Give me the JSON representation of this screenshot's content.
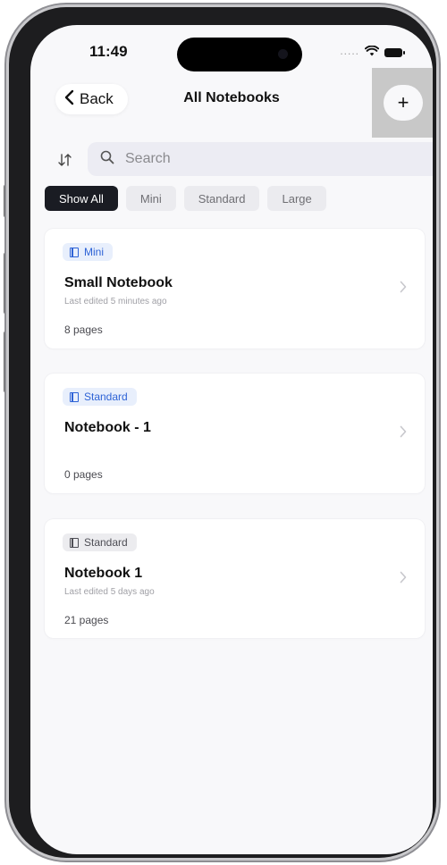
{
  "status_bar": {
    "time": "11:49",
    "dots": "....."
  },
  "nav": {
    "back_label": "Back",
    "title": "All Notebooks",
    "add_label": "+"
  },
  "search": {
    "placeholder": "Search"
  },
  "filters": {
    "show_all": "Show All",
    "mini": "Mini",
    "standard": "Standard",
    "large": "Large"
  },
  "notebooks": [
    {
      "badge": "Mini",
      "badge_style": "blue",
      "title": "Small Notebook",
      "subtitle": "Last edited 5 minutes ago",
      "pages": "8 pages"
    },
    {
      "badge": "Standard",
      "badge_style": "blue",
      "title": "Notebook - 1",
      "subtitle": "",
      "pages": "0 pages"
    },
    {
      "badge": "Standard",
      "badge_style": "grey",
      "title": "Notebook 1",
      "subtitle": "Last edited 5 days ago",
      "pages": "21 pages"
    }
  ],
  "colors": {
    "accent": "#2e63d6",
    "active_chip": "#1a1c23",
    "screen_bg": "#f8f8fa"
  },
  "icons": [
    "back-chevron-icon",
    "add-icon",
    "sort-icon",
    "search-icon",
    "notebook-icon",
    "chevron-right-icon",
    "wifi-icon",
    "battery-icon"
  ]
}
